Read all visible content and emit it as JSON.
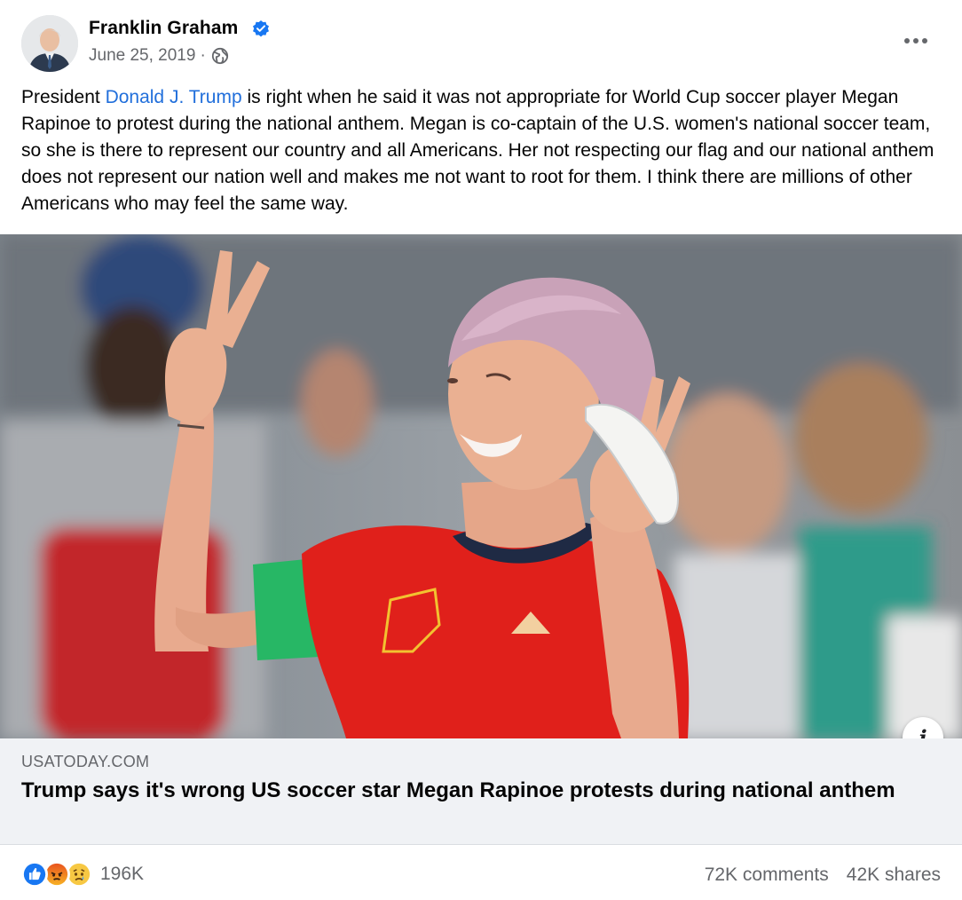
{
  "post": {
    "author": "Franklin Graham",
    "verified_icon": "verified-badge-icon",
    "date": "June 25, 2019",
    "separator": "·",
    "audience_icon": "globe-icon",
    "more_icon": "more-options-icon",
    "text_before_link": "President ",
    "mention": "Donald J. Trump",
    "text_after_link": " is right when he said it was not appropriate for World Cup soccer player Megan Rapinoe to protest during the national anthem. Megan is co-captain of the U.S. women's national soccer team, so she is there to represent our country and all Americans. Her not respecting our flag and our national anthem does not represent our nation well and makes me not want to root for them.  I think there are millions of other Americans who may feel the same way."
  },
  "link_preview": {
    "domain": "USATODAY.COM",
    "title": "Trump says it's wrong US soccer star Megan Rapinoe protests during national anthem",
    "info_label": "i"
  },
  "engagement": {
    "reactions": [
      "like-reaction-icon",
      "angry-reaction-icon",
      "sad-reaction-icon"
    ],
    "reaction_count": "196K",
    "comments": "72K comments",
    "shares": "42K shares"
  },
  "colors": {
    "link": "#216fdb",
    "secondary_text": "#65676b",
    "like": "#1877f2",
    "jersey": "#e0201b",
    "armband": "#27b765"
  }
}
